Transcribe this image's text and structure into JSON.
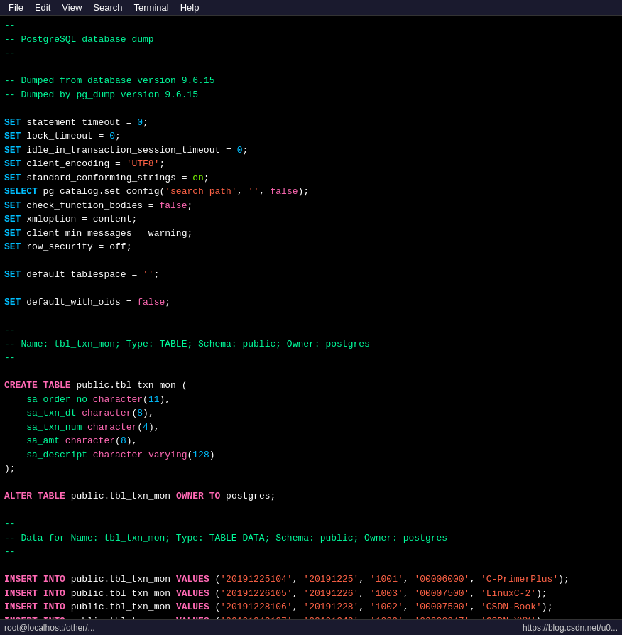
{
  "menubar": {
    "items": [
      "File",
      "Edit",
      "View",
      "Search",
      "Terminal",
      "Help"
    ]
  },
  "statusbar": {
    "left": "root@localhost:/other/...",
    "right": "https://blog.csdn.net/u0..."
  },
  "code": {
    "title": "-- PostgreSQL database dump",
    "version_from": "-- Dumped from database version 9.6.15",
    "version_by": "-- Dumped by pg_dump version 9.6.15"
  }
}
